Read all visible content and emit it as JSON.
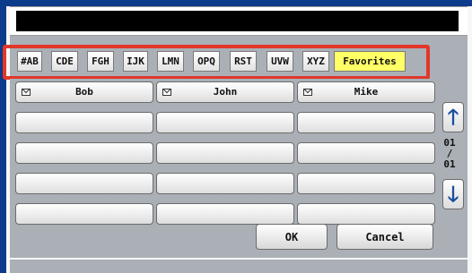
{
  "input": {
    "value": ""
  },
  "tabs": [
    {
      "label": "#AB",
      "active": false
    },
    {
      "label": "CDE",
      "active": false
    },
    {
      "label": "FGH",
      "active": false
    },
    {
      "label": "IJK",
      "active": false
    },
    {
      "label": "LMN",
      "active": false
    },
    {
      "label": "OPQ",
      "active": false
    },
    {
      "label": "RST",
      "active": false
    },
    {
      "label": "UVW",
      "active": false
    },
    {
      "label": "XYZ",
      "active": false
    },
    {
      "label": "Favorites",
      "active": true
    }
  ],
  "contacts": {
    "row1": [
      {
        "name": "Bob",
        "icon": "mail-icon"
      },
      {
        "name": "John",
        "icon": "mail-icon"
      },
      {
        "name": "Mike",
        "icon": "mail-icon"
      }
    ]
  },
  "pagination": {
    "current": "01",
    "separator": "/",
    "total": "01"
  },
  "buttons": {
    "ok": "OK",
    "cancel": "Cancel"
  },
  "colors": {
    "frame_blue": "#0d3b8c",
    "highlight_red": "#e2372a",
    "active_tab": "#ffff66",
    "arrow_blue": "#1a4fa0"
  }
}
